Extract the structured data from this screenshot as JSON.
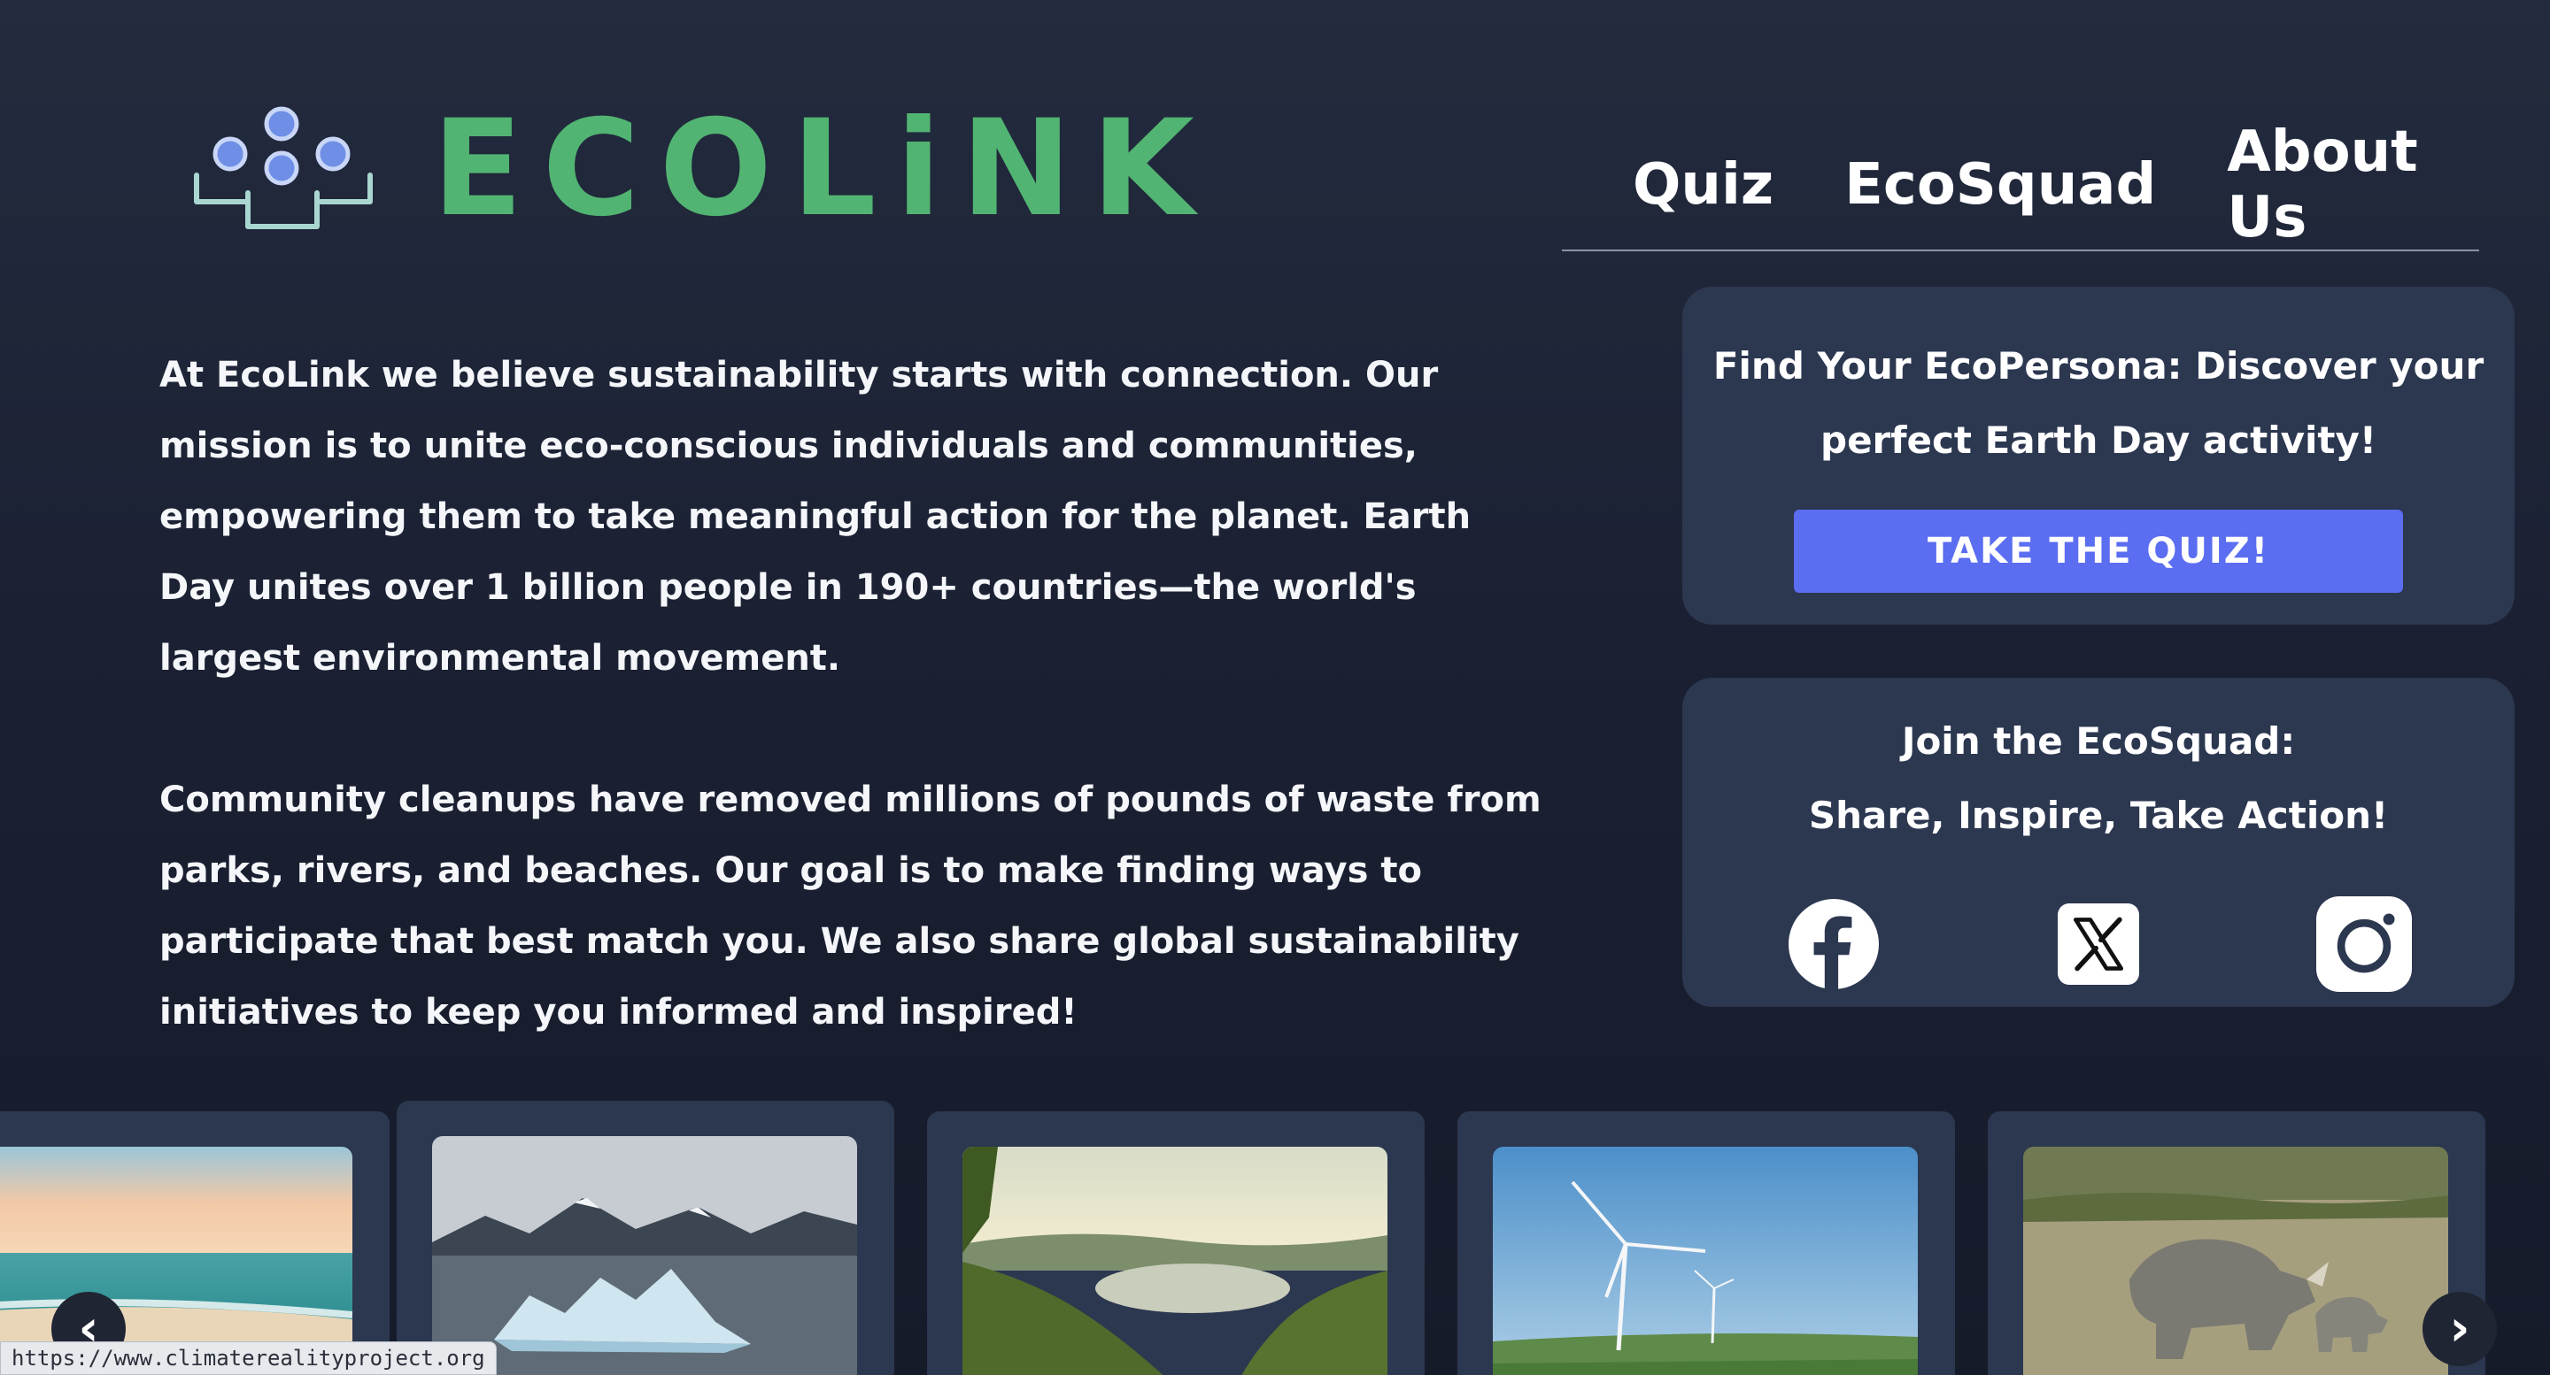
{
  "brand": {
    "name": "ECOLiNK",
    "color": "#52b472",
    "mark_icon": "people-connection-icon"
  },
  "nav": {
    "items": [
      {
        "label": "Quiz"
      },
      {
        "label": "EcoSquad"
      },
      {
        "label": "About Us"
      }
    ]
  },
  "intro": {
    "paragraph_1": "At EcoLink we believe sustainability starts with connection. Our mission is to unite eco-conscious individuals and communities, empowering them to take meaningful action for the planet. Earth Day unites over 1 billion people in 190+ countries—the world's largest environmental movement.",
    "paragraph_2": "Community cleanups have removed millions of pounds of waste from parks, rivers, and beaches. Our goal is to make finding ways to participate that best match you. We also share global sustainability initiatives to keep you informed and inspired!"
  },
  "quiz_card": {
    "text_line_1": "Find Your EcoPersona: Discover your",
    "text_line_2": "perfect Earth Day activity!",
    "button_label": "TAKE THE QUIZ!",
    "button_color": "#5b6df0"
  },
  "squad_card": {
    "title_line_1": "Join the EcoSquad:",
    "title_line_2": "Share, Inspire, Take Action!",
    "socials": [
      {
        "icon": "facebook-icon"
      },
      {
        "icon": "x-twitter-icon"
      },
      {
        "icon": "instagram-icon"
      }
    ]
  },
  "carousel": {
    "slides": [
      {
        "image": "ocean-beach-sunset"
      },
      {
        "image": "iceberg-mountains"
      },
      {
        "image": "forest-river-valley"
      },
      {
        "image": "wind-turbines-field"
      },
      {
        "image": "rhinos-grassland"
      }
    ],
    "prev_label": "‹",
    "next_label": "›"
  },
  "status_bar": {
    "url": "https://www.climaterealityproject.org"
  },
  "colors": {
    "background": "#1b2133",
    "card": "#2c3750",
    "accent": "#5b6df0"
  }
}
